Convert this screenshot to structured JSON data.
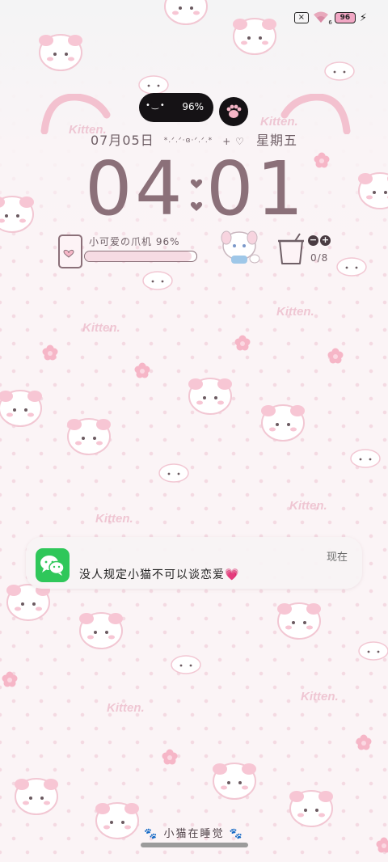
{
  "status": {
    "sim_icon": "x-sim-icon",
    "wifi_badge": "6",
    "battery_level": "96",
    "charging_icon": "lightning-icon"
  },
  "widget": {
    "pill_face": "•‿•",
    "pill_battery": "96%",
    "paw_icon": "paw-icon"
  },
  "date": {
    "date_text": "07月05日",
    "kaomoji": "*.ᐟ.ᐟ·ɞ·ᐟ.ᐟ.*",
    "deco": "+ ♡",
    "weekday": "星期五"
  },
  "clock": {
    "hour_tens": "0",
    "hour_ones": "4",
    "minute_tens": "0",
    "minute_ones": "1"
  },
  "battery_widget": {
    "label": "小可爱の爪机  96%",
    "level": 0.96
  },
  "water": {
    "counter": "0/8",
    "minus": "−",
    "plus": "+"
  },
  "notification": {
    "app_icon": "wechat-icon",
    "time": "现在",
    "message": "没人规定小猫不可以谈恋爱💗"
  },
  "bottom": {
    "text": "小猫在睡觉"
  },
  "colors": {
    "accent": "#8b7079",
    "background": "#fbf4f6",
    "wechat": "#2fc75a"
  }
}
